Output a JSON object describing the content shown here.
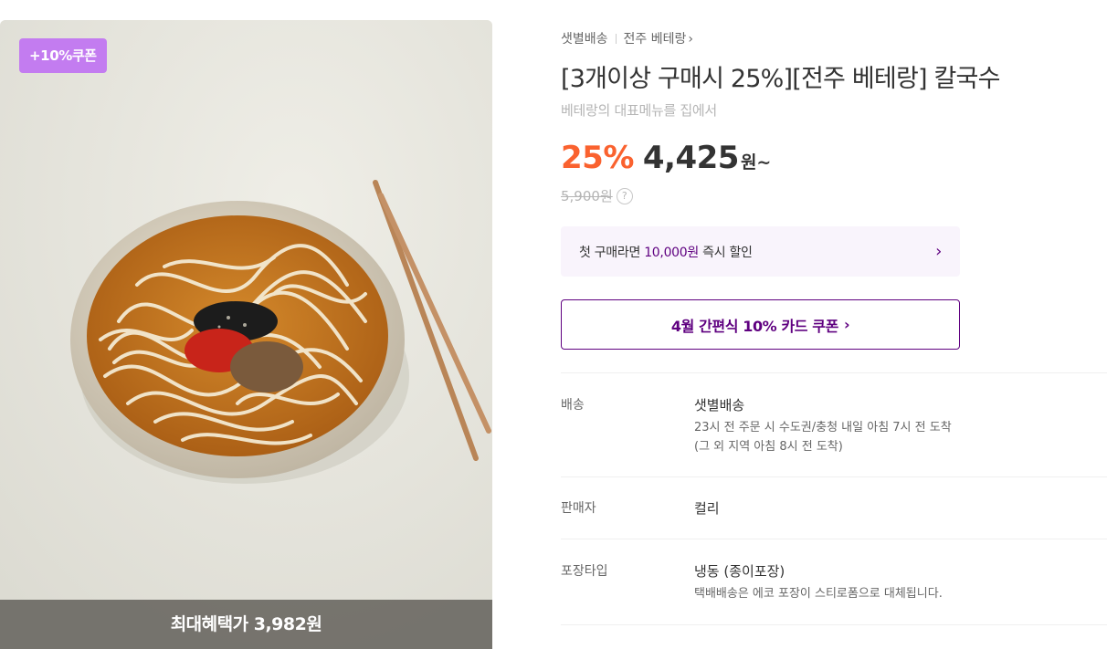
{
  "image": {
    "coupon_badge": "+10%쿠폰",
    "max_benefit": "최대혜택가 3,982원"
  },
  "breadcrumb": {
    "delivery": "샛별배송",
    "brand": "전주 베테랑",
    "chevron": "›"
  },
  "product": {
    "title": "[3개이상 구매시 25%][전주 베테랑] 칼국수",
    "subtitle": "베테랑의 대표메뉴를 집에서",
    "discount": "25%",
    "price": "4,425",
    "price_unit": "원~",
    "original_price": "5,900원",
    "help_icon": "?"
  },
  "first_purchase": {
    "prefix": "첫 구매라면 ",
    "amount": "10,000원",
    "suffix": " 즉시 할인",
    "arrow": "›"
  },
  "card_coupon": {
    "label": "4월 간편식 10% 카드 쿠폰",
    "chevron": "›"
  },
  "details": {
    "delivery": {
      "label": "배송",
      "value": "샛별배송",
      "line1": "23시 전 주문 시 수도권/충청 내일 아침 7시 전 도착",
      "line2": "(그 외 지역 아침 8시 전 도착)"
    },
    "seller": {
      "label": "판매자",
      "value": "컬리"
    },
    "packaging": {
      "label": "포장타입",
      "value": "냉동 (종이포장)",
      "line1": "택배배송은 에코 포장이 스티로폼으로 대체됩니다."
    }
  },
  "colors": {
    "discount": "#fa622f",
    "kurly_purple": "#5f0080",
    "coupon_badge": "#c37cf0"
  }
}
